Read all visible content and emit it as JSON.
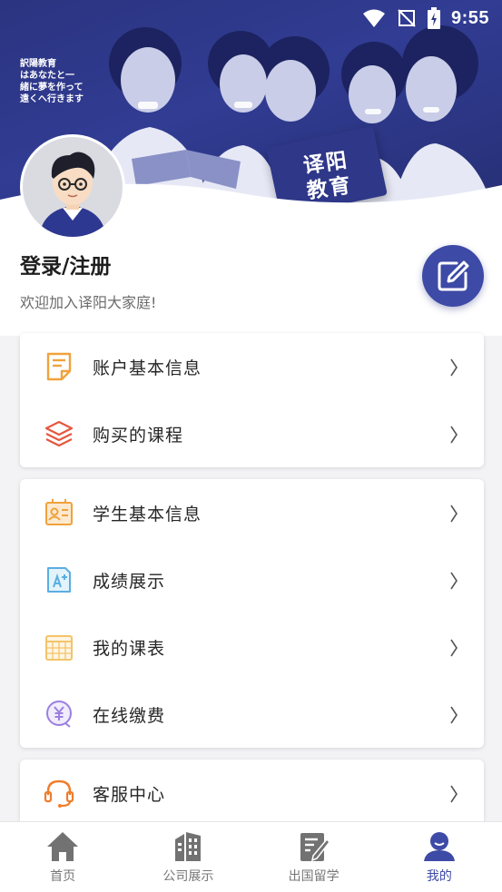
{
  "status_bar": {
    "time": "9:55"
  },
  "hero": {
    "caption_lines": [
      "訳陽教育",
      "はあなたと一",
      "緒に夢を作って",
      "遠くへ行きます"
    ],
    "brand_lines": [
      "译阳",
      "教育"
    ]
  },
  "profile": {
    "login_title": "登录/注册",
    "welcome_text": "欢迎加入译阳大家庭!"
  },
  "menu_groups": [
    {
      "items": [
        {
          "label": "账户基本信息",
          "icon": "notepad-icon"
        },
        {
          "label": "购买的课程",
          "icon": "layers-icon"
        }
      ]
    },
    {
      "items": [
        {
          "label": "学生基本信息",
          "icon": "id-card-icon"
        },
        {
          "label": "成绩展示",
          "icon": "grade-icon"
        },
        {
          "label": "我的课表",
          "icon": "calendar-icon"
        },
        {
          "label": "在线缴费",
          "icon": "yen-payment-icon"
        }
      ]
    },
    {
      "items": [
        {
          "label": "客服中心",
          "icon": "headset-icon"
        }
      ]
    }
  ],
  "bottom_nav": [
    {
      "label": "首页",
      "icon": "home-icon",
      "active": false
    },
    {
      "label": "公司展示",
      "icon": "building-icon",
      "active": false
    },
    {
      "label": "出国留学",
      "icon": "document-edit-icon",
      "active": false
    },
    {
      "label": "我的",
      "icon": "user-icon",
      "active": true
    }
  ],
  "colors": {
    "accent": "#3d4aa6",
    "hero_bg": "#2e3788",
    "icon_orange": "#f0a23c",
    "icon_red": "#e5573e",
    "icon_blue": "#5aaee0",
    "icon_purple": "#9a7fe0"
  }
}
